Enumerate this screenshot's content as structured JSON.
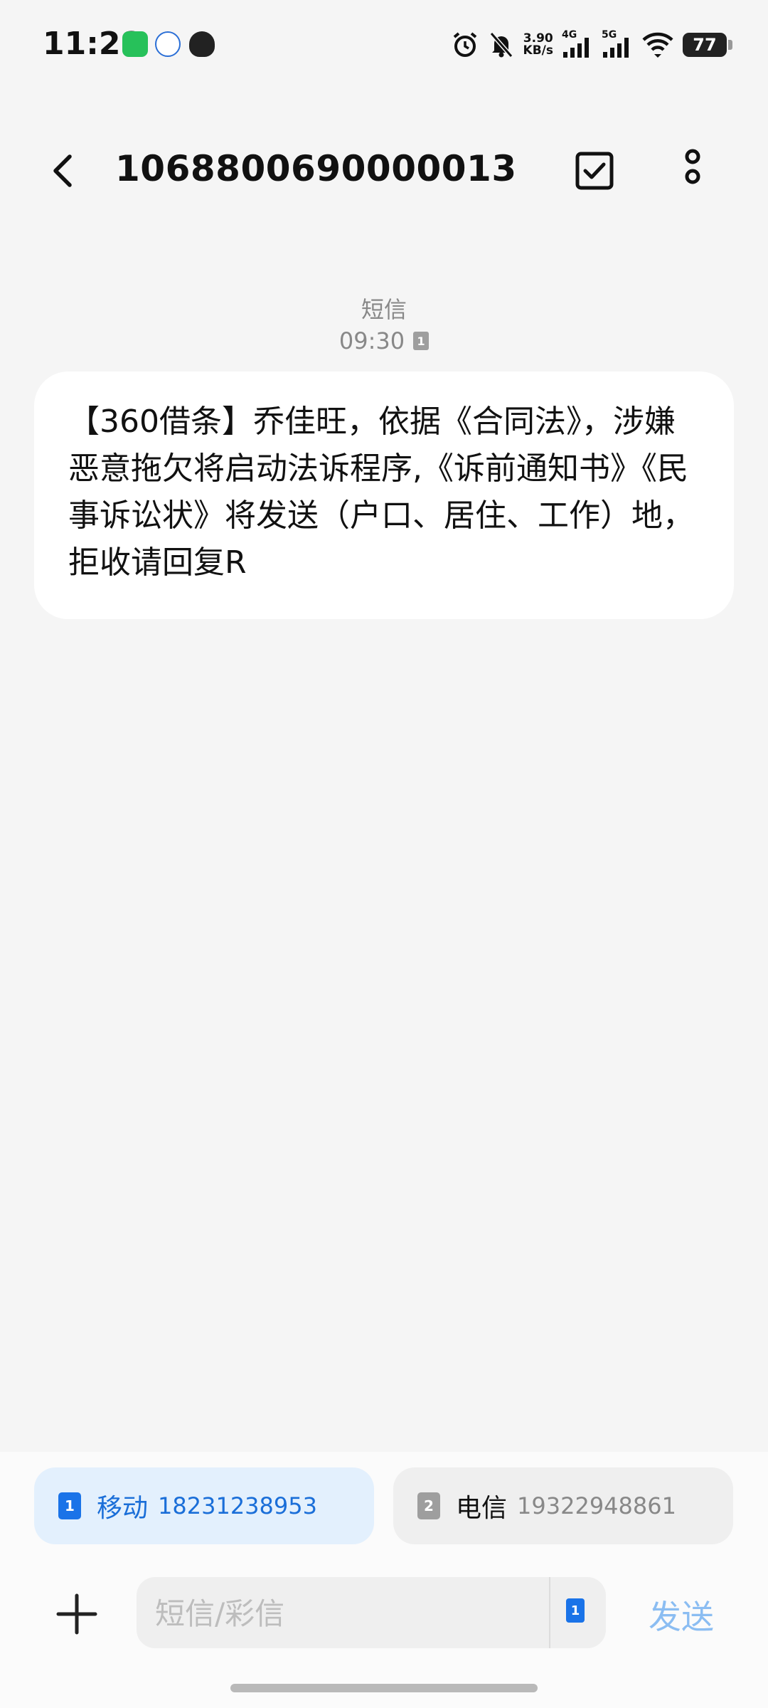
{
  "status_bar": {
    "time": "11:28",
    "notifications": [
      "wechat-icon",
      "app-icon",
      "qq-icon"
    ],
    "net_speed_value": "3.90",
    "net_speed_unit": "KB/s",
    "net_4g": "4G",
    "net_5g": "5G",
    "battery": "77"
  },
  "header": {
    "title": "1068800690000013"
  },
  "message": {
    "type_label": "短信",
    "time": "09:30",
    "sim_slot": "1",
    "body": "【360借条】乔佳旺，依据《合同法》，涉嫌恶意拖欠将启动法诉程序,《诉前通知书》《民事诉讼状》将发送（户口、居住、工作）地，拒收请回复R"
  },
  "sims": [
    {
      "slot": "1",
      "carrier": "移动",
      "number": "18231238953"
    },
    {
      "slot": "2",
      "carrier": "电信",
      "number": "19322948861"
    }
  ],
  "composer": {
    "placeholder": "短信/彩信",
    "send_label": "发送",
    "selected_sim": "1"
  },
  "colors": {
    "accent": "#1a73e8",
    "send_disabled": "#8bbdf2",
    "background": "#f5f5f5"
  }
}
